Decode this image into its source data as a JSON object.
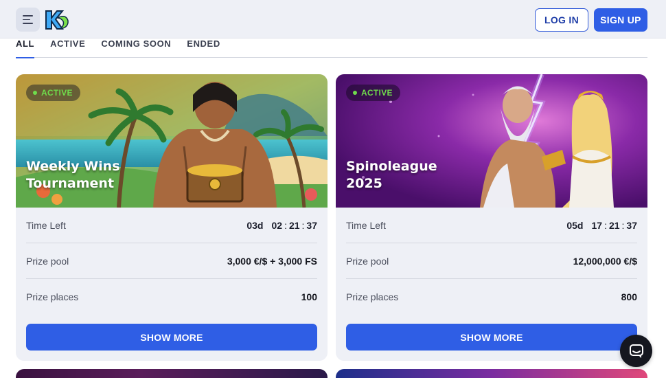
{
  "header": {
    "login_label": "LOG IN",
    "signup_label": "SIGN UP"
  },
  "tabs": [
    {
      "label": "ALL",
      "active": true
    },
    {
      "label": "ACTIVE",
      "active": false
    },
    {
      "label": "COMING SOON",
      "active": false
    },
    {
      "label": "ENDED",
      "active": false
    }
  ],
  "tournaments": [
    {
      "status": "ACTIVE",
      "title_line1": "Weekly Wins",
      "title_line2": "Tournament",
      "time_left_label": "Time Left",
      "time_days": "03d",
      "time_h": "02",
      "time_m": "21",
      "time_s": "37",
      "prize_pool_label": "Prize pool",
      "prize_pool": "3,000 €/$ + 3,000 FS",
      "prize_places_label": "Prize places",
      "prize_places": "100",
      "button_label": "SHOW MORE"
    },
    {
      "status": "ACTIVE",
      "title_line1": "Spinoleague",
      "title_line2": "2025",
      "time_left_label": "Time Left",
      "time_days": "05d",
      "time_h": "17",
      "time_m": "21",
      "time_s": "37",
      "prize_pool_label": "Prize pool",
      "prize_pool": "12,000,000 €/$",
      "prize_places_label": "Prize places",
      "prize_places": "800",
      "button_label": "SHOW MORE"
    }
  ],
  "colors": {
    "accent": "#2f5ee5",
    "active_badge": "#6fdc4c",
    "header_bg": "#eef0f6"
  },
  "icons": [
    "hamburger-menu-icon",
    "casino-logo",
    "chat-icon"
  ]
}
